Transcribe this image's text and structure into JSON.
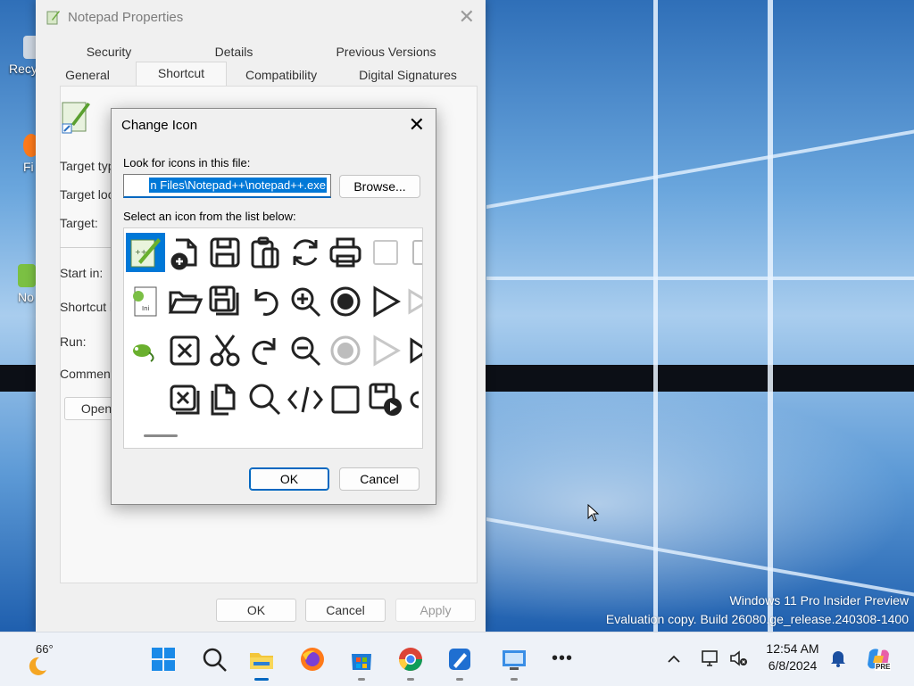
{
  "desktop": {
    "icons": [
      "Recy",
      "Fi",
      "No"
    ],
    "watermark": {
      "line1": "Windows 11 Pro Insider Preview",
      "line2": "Evaluation copy. Build 26080.ge_release.240308-1400"
    }
  },
  "properties_window": {
    "title": "Notepad Properties",
    "tabs_top": [
      "Security",
      "Details",
      "Previous Versions"
    ],
    "tabs_bottom": [
      "General",
      "Shortcut",
      "Compatibility",
      "Digital Signatures"
    ],
    "selected_tab": "Shortcut",
    "labels": {
      "target_type": "Target typ",
      "target_location": "Target loc",
      "target": "Target:",
      "start_in": "Start in:",
      "shortcut_key": "Shortcut k",
      "run": "Run:",
      "comment": "Comment:"
    },
    "open_button": "Open",
    "ok_button": "OK",
    "cancel_button": "Cancel",
    "apply_button": "Apply"
  },
  "change_icon_dialog": {
    "title": "Change Icon",
    "look_label": "Look for icons in this file:",
    "file_path": "n Files\\Notepad++\\notepad++.exe",
    "browse_button": "Browse...",
    "select_label": "Select an icon from the list below:",
    "ok_button": "OK",
    "cancel_button": "Cancel",
    "icon_rows": [
      [
        "notepadpp-app-icon",
        "new-file-plus-icon",
        "save-icon",
        "clipboard-icon",
        "refresh-icon",
        "print-icon",
        "blank-square-icon",
        "partial-icon"
      ],
      [
        "notepadpp-document-icon",
        "open-folder-icon",
        "save-all-icon",
        "undo-icon",
        "zoom-in-icon",
        "record-icon",
        "play-icon",
        "partial-play-icon"
      ],
      [
        "notepadpp-chameleon-icon",
        "close-box-icon",
        "cut-icon",
        "redo-icon",
        "zoom-out-icon",
        "record-disabled-icon",
        "play-disabled-icon",
        "partial-play-icon"
      ],
      [
        "empty",
        "close-all-icon",
        "copy-icon",
        "find-icon",
        "code-icon",
        "stop-icon",
        "save-macro-icon",
        "partial-icon"
      ]
    ]
  },
  "taskbar": {
    "weather_temp": "66°",
    "time": "12:54 AM",
    "date": "6/8/2024",
    "copilot_badge": "PRE",
    "accent": "#0067c0"
  }
}
